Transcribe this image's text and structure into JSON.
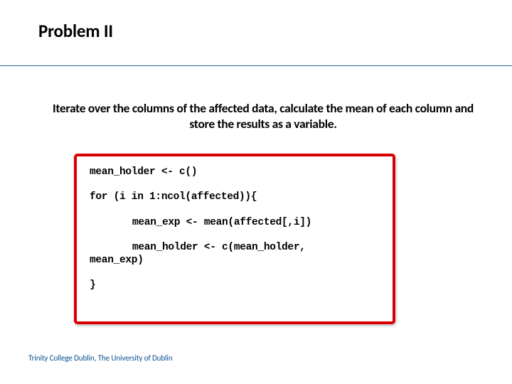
{
  "title": "Problem II",
  "body_text": "Iterate over the columns of the affected data, calculate the mean of each column and store the results as a variable.",
  "code": {
    "l1": "mean_holder <- c()",
    "l2": "for (i in 1:ncol(affected)){",
    "l3": "mean_exp <- mean(affected[,i])",
    "l4a": "mean_holder <- c(mean_holder,",
    "l4b": "mean_exp)",
    "l5": "}"
  },
  "footer": "Trinity College Dublin, The University of Dublin"
}
